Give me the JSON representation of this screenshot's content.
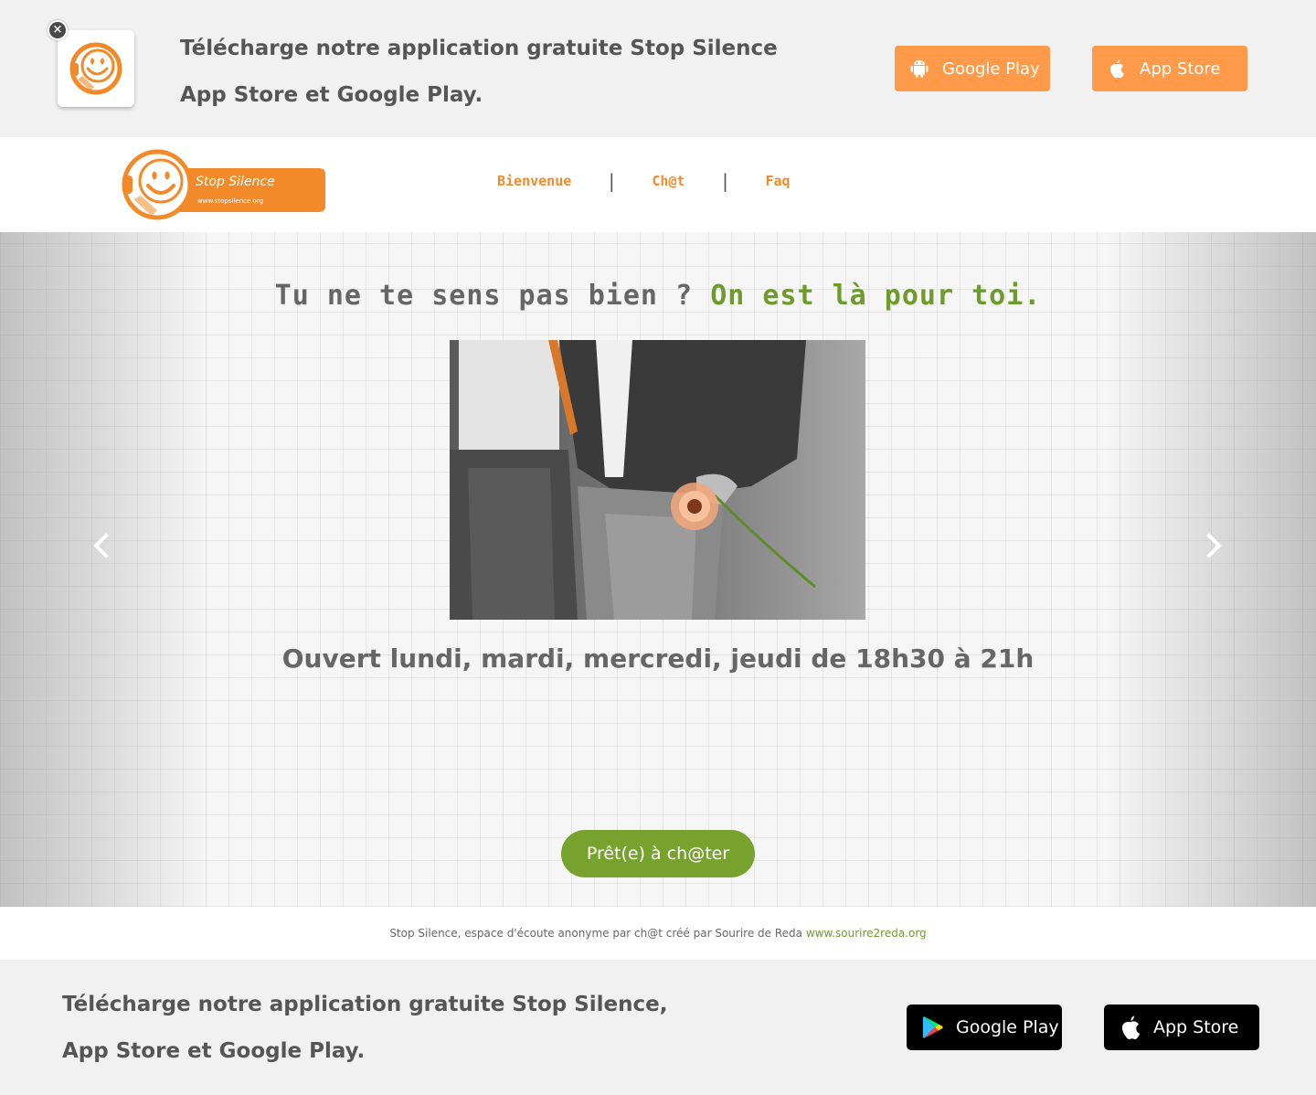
{
  "top_banner": {
    "close_label": "×",
    "line1": "Télécharge notre application gratuite Stop Silence",
    "line2": "App Store et Google Play.",
    "google_play_label": "Google Play",
    "app_store_label": "App Store",
    "google_play_icon": "android-icon",
    "app_store_icon": "apple-icon"
  },
  "header": {
    "logo_title": "Stop Silence",
    "logo_url": "www.stopsilence.org",
    "nav": [
      {
        "label": "Bienvenue"
      },
      {
        "label": "Ch@t"
      },
      {
        "label": "Faq"
      }
    ],
    "separator": "|"
  },
  "hero": {
    "heading_question": "Tu ne te sens pas bien ?",
    "heading_answer": "On est là pour toi.",
    "hours": "Ouvert lundi, mardi, mercredi, jeudi de 18h30 à 21h",
    "chat_button": "Prêt(e) à ch@ter"
  },
  "credit": {
    "text": "Stop Silence, espace d'écoute anonyme par ch@t créé par Sourire de Reda",
    "link": "www.sourire2reda.org"
  },
  "bottom_banner": {
    "line1": "Télécharge notre application gratuite Stop Silence,",
    "line2": "App Store et Google Play.",
    "google_play_label": "Google Play",
    "app_store_label": "App Store"
  },
  "colors": {
    "orange": "#f28a2a",
    "orange_button": "#ff9a4a",
    "green": "#78a22e",
    "text_gray": "#555555"
  }
}
